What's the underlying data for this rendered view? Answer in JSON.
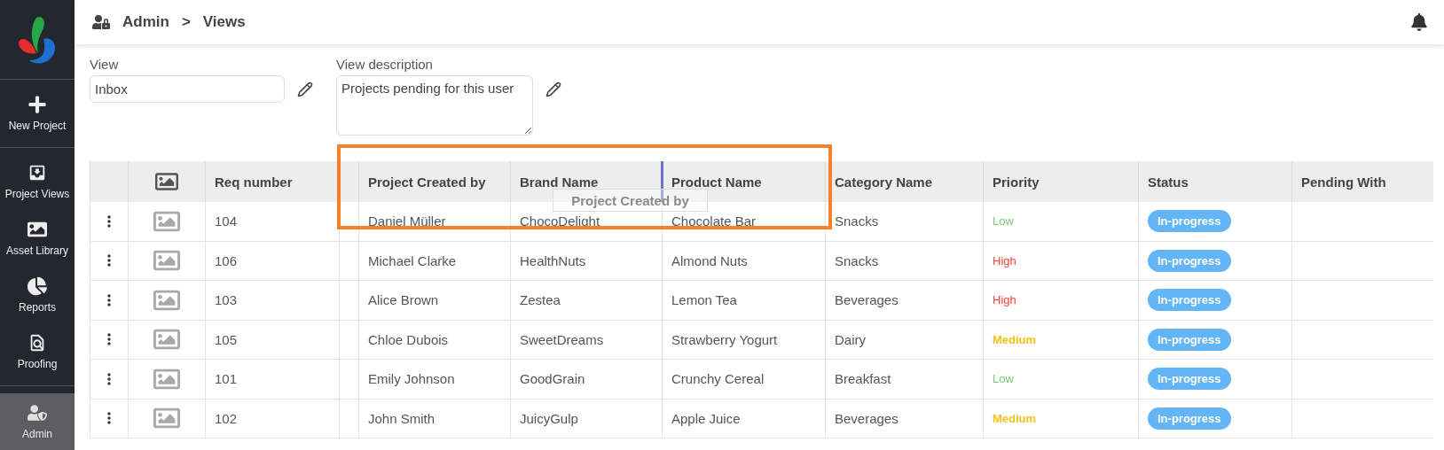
{
  "sidebar": {
    "items": [
      {
        "label": "New Project",
        "selected": false
      },
      {
        "label": "Project Views",
        "selected": false
      },
      {
        "label": "Asset Library",
        "selected": false
      },
      {
        "label": "Reports",
        "selected": false
      },
      {
        "label": "Proofing",
        "selected": false
      },
      {
        "label": "Admin",
        "selected": true
      }
    ]
  },
  "breadcrumb": [
    "Admin",
    ">",
    "Views"
  ],
  "form": {
    "view": {
      "label": "View",
      "value": "Inbox"
    },
    "description": {
      "label": "View description",
      "value": "Projects pending for this user"
    }
  },
  "table": {
    "columns": [
      "Req number",
      "",
      "Project Created by",
      "Brand Name",
      "Product Name",
      "Category Name",
      "Priority",
      "Status",
      "Pending With"
    ],
    "rows": [
      {
        "req": "104",
        "created_by": "Daniel Müller",
        "brand": "ChocoDelight",
        "product": "Chocolate Bar",
        "category": "Snacks",
        "priority": {
          "text": "Low",
          "kind": "low"
        },
        "status": "In-progress"
      },
      {
        "req": "106",
        "created_by": "Michael Clarke",
        "brand": "HealthNuts",
        "product": "Almond Nuts",
        "category": "Snacks",
        "priority": {
          "text": "High",
          "kind": "high"
        },
        "status": "In-progress"
      },
      {
        "req": "103",
        "created_by": "Alice Brown",
        "brand": "Zestea",
        "product": "Lemon Tea",
        "category": "Beverages",
        "priority": {
          "text": "High",
          "kind": "high"
        },
        "status": "In-progress"
      },
      {
        "req": "105",
        "created_by": "Chloe Dubois",
        "brand": "SweetDreams",
        "product": "Strawberry Yogurt",
        "category": "Dairy",
        "priority": {
          "text": "Medium",
          "kind": "medium"
        },
        "status": "In-progress"
      },
      {
        "req": "101",
        "created_by": "Emily Johnson",
        "brand": "GoodGrain",
        "product": "Crunchy Cereal",
        "category": "Breakfast",
        "priority": {
          "text": "Low",
          "kind": "low"
        },
        "status": "In-progress"
      },
      {
        "req": "102",
        "created_by": "John Smith",
        "brand": "JuicyGulp",
        "product": "Apple Juice",
        "category": "Beverages",
        "priority": {
          "text": "Medium",
          "kind": "medium"
        },
        "status": "In-progress"
      }
    ],
    "drag_ghost": "Project Created by",
    "highlight": true
  }
}
